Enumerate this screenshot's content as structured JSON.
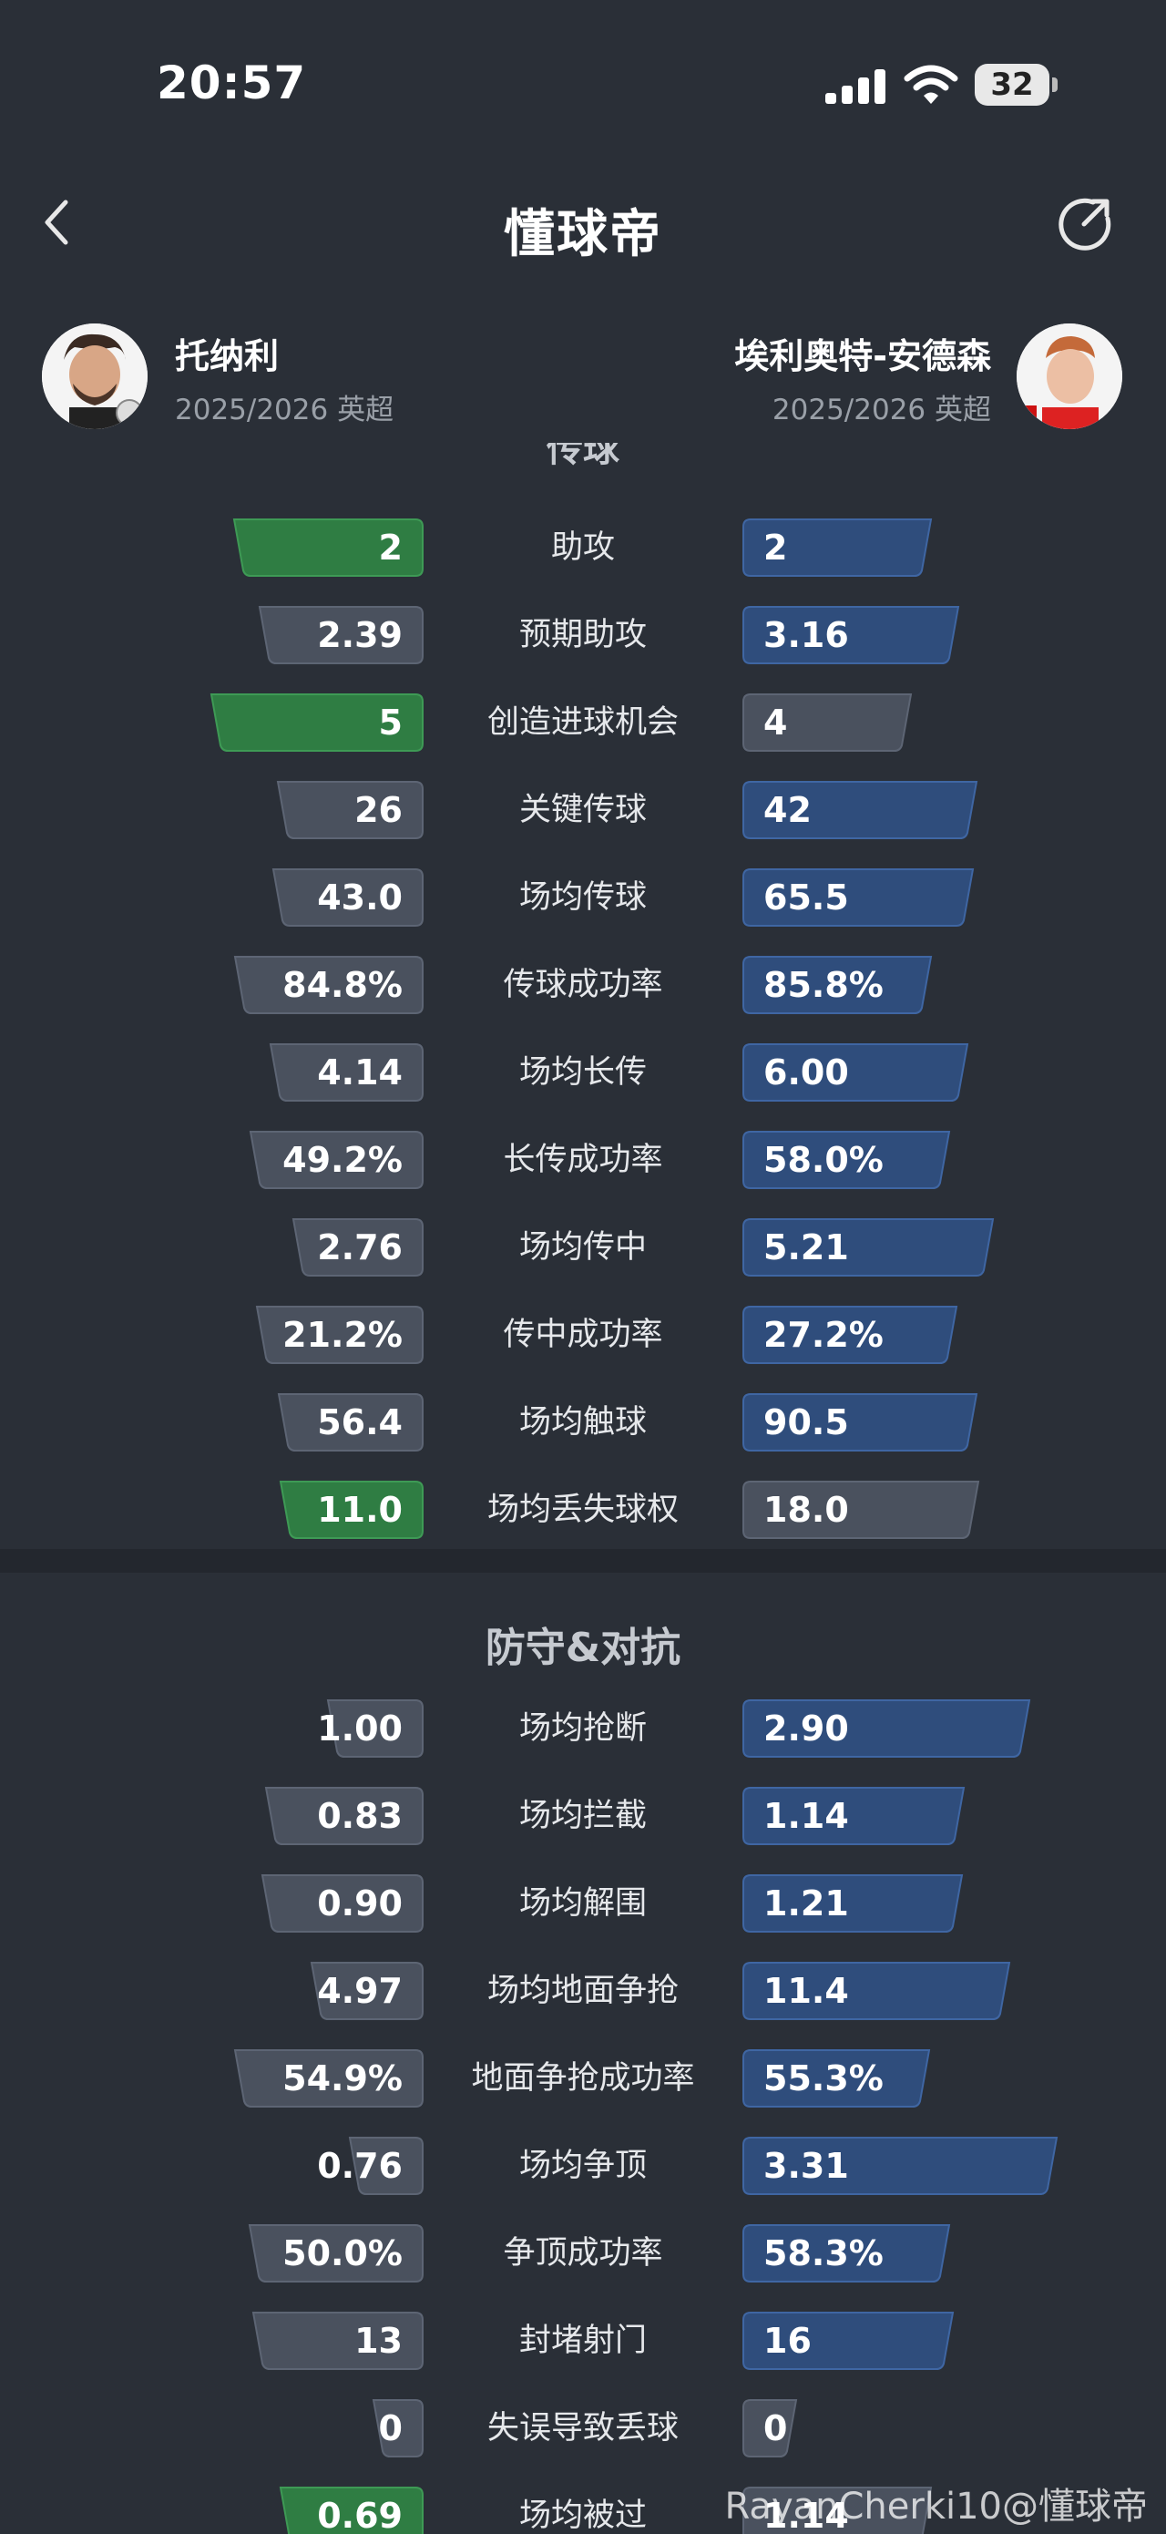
{
  "status_bar": {
    "time": "20:57",
    "battery": "32"
  },
  "header": {
    "brand": "懂球帝"
  },
  "players": {
    "left": {
      "name": "托纳利",
      "season": "2025/2026 英超"
    },
    "right": {
      "name": "埃利奥特-安德森",
      "season": "2025/2026 英超"
    }
  },
  "sections": {
    "passing_partial": "传球",
    "defense_title": "防守&对抗"
  },
  "colors": {
    "left_highlight": "#2e7d3f",
    "left_normal": "#4b5260",
    "right_blue": "#2f4d7c",
    "right_gray": "#4b5260"
  },
  "rows": [
    {
      "label": "助攻",
      "left": "2",
      "right": "2",
      "left_win": true,
      "right_win": true
    },
    {
      "label": "预期助攻",
      "left": "2.39",
      "right": "3.16",
      "left_win": false,
      "right_win": true
    },
    {
      "label": "创造进球机会",
      "left": "5",
      "right": "4",
      "left_win": true,
      "right_win": false
    },
    {
      "label": "关键传球",
      "left": "26",
      "right": "42",
      "left_win": false,
      "right_win": true
    },
    {
      "label": "场均传球",
      "left": "43.0",
      "right": "65.5",
      "left_win": false,
      "right_win": true
    },
    {
      "label": "传球成功率",
      "left": "84.8%",
      "right": "85.8%",
      "left_win": false,
      "right_win": true
    },
    {
      "label": "场均长传",
      "left": "4.14",
      "right": "6.00",
      "left_win": false,
      "right_win": true
    },
    {
      "label": "长传成功率",
      "left": "49.2%",
      "right": "58.0%",
      "left_win": false,
      "right_win": true
    },
    {
      "label": "场均传中",
      "left": "2.76",
      "right": "5.21",
      "left_win": false,
      "right_win": true
    },
    {
      "label": "传中成功率",
      "left": "21.2%",
      "right": "27.2%",
      "left_win": false,
      "right_win": true
    },
    {
      "label": "场均触球",
      "left": "56.4",
      "right": "90.5",
      "left_win": false,
      "right_win": true
    },
    {
      "label": "场均丢失球权",
      "left": "11.0",
      "right": "18.0",
      "left_win": true,
      "right_win": false
    },
    {
      "label": "场均抢断",
      "left": "1.00",
      "right": "2.90",
      "left_win": false,
      "right_win": true
    },
    {
      "label": "场均拦截",
      "left": "0.83",
      "right": "1.14",
      "left_win": false,
      "right_win": true
    },
    {
      "label": "场均解围",
      "left": "0.90",
      "right": "1.21",
      "left_win": false,
      "right_win": true
    },
    {
      "label": "场均地面争抢",
      "left": "4.97",
      "right": "11.4",
      "left_win": false,
      "right_win": true
    },
    {
      "label": "地面争抢成功率",
      "left": "54.9%",
      "right": "55.3%",
      "left_win": false,
      "right_win": true
    },
    {
      "label": "场均争顶",
      "left": "0.76",
      "right": "3.31",
      "left_win": false,
      "right_win": true
    },
    {
      "label": "争顶成功率",
      "left": "50.0%",
      "right": "58.3%",
      "left_win": false,
      "right_win": true
    },
    {
      "label": "封堵射门",
      "left": "13",
      "right": "16",
      "left_win": false,
      "right_win": true
    },
    {
      "label": "失误导致丢球",
      "left": "0",
      "right": "0",
      "left_win": false,
      "right_win": false
    },
    {
      "label": "场均被过",
      "left": "0.69",
      "right": "1.14",
      "left_win": true,
      "right_win": false
    }
  ],
  "watermark": "RayanCherki10@懂球帝"
}
